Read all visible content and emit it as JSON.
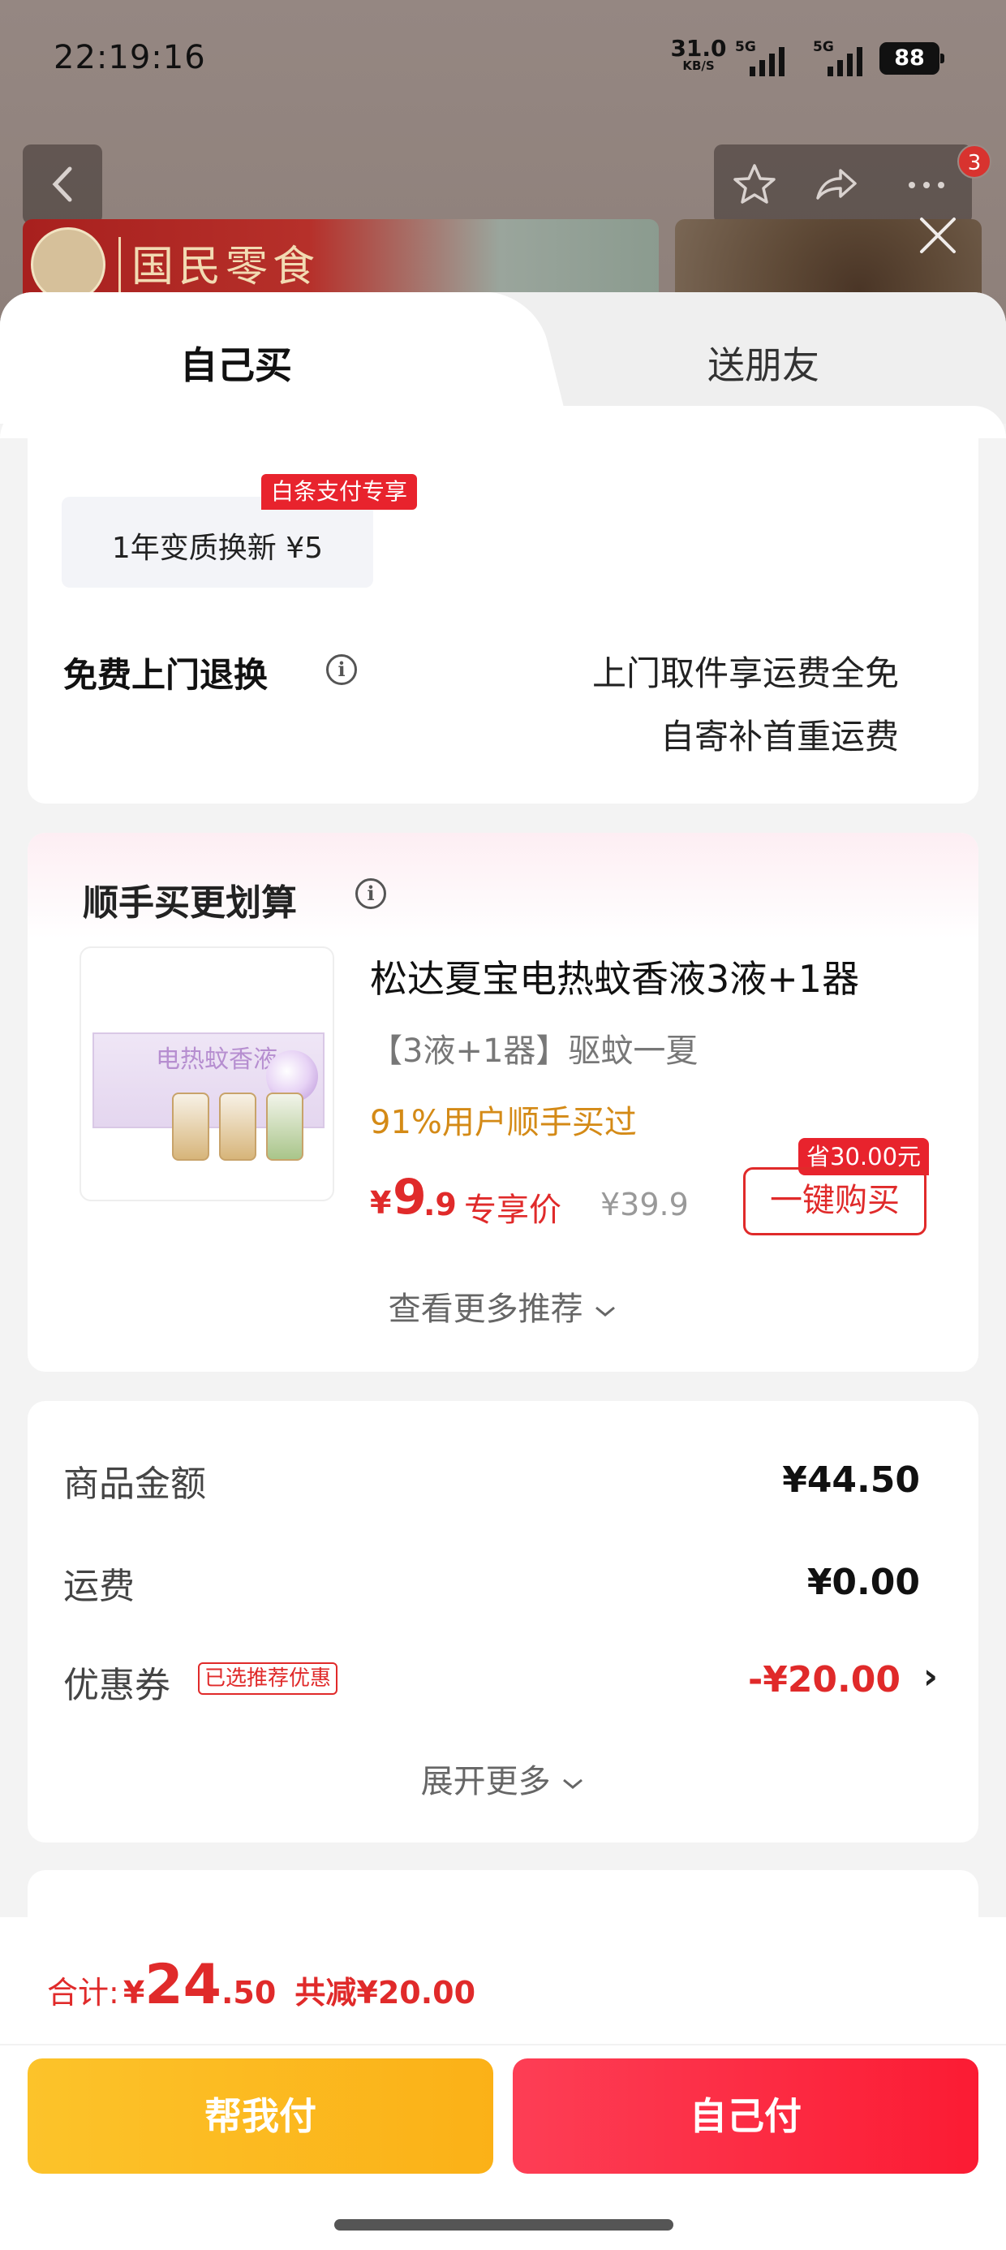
{
  "status_bar": {
    "time": "22:19:16",
    "net_speed": "31.0",
    "net_unit": "KB/S",
    "signal1": "5G",
    "signal2": "5G",
    "battery": "88"
  },
  "header": {
    "cart_count": "3",
    "banner_brand": "国民零食"
  },
  "tabs": [
    {
      "label": "自己买",
      "active": true
    },
    {
      "label": "送朋友",
      "active": false
    }
  ],
  "service": {
    "chip_label": "1年变质换新  ¥5",
    "chip_badge": "白条支付专享",
    "return_title": "免费上门退换",
    "return_line1": "上门取件享运费全免",
    "return_line2": "自寄补首重运费"
  },
  "recommend": {
    "title": "顺手买更划算",
    "product_name": "松达夏宝电热蚊香液3液+1器",
    "product_spec": "【3液+1器】驱蚊一夏",
    "product_box_text": "电热蚊香液",
    "buyers_text": "91%用户顺手买过",
    "price_symbol": "¥",
    "price_int": "9",
    "price_dec": ".9",
    "price_label": "专享价",
    "original_price": "¥39.9",
    "save_badge": "省30.00元",
    "buy_button": "一键购买",
    "more_link": "查看更多推荐"
  },
  "summary": {
    "goods_label": "商品金额",
    "goods_value": "¥44.50",
    "shipping_label": "运费",
    "shipping_value": "¥0.00",
    "coupon_label": "优惠券",
    "coupon_tag": "已选推荐优惠",
    "coupon_value": "-¥20.00",
    "expand_label": "展开更多"
  },
  "footer": {
    "total_label": "合计:",
    "total_symbol": "¥",
    "total_int": "24",
    "total_dec": ".50",
    "reduced": "共减¥20.00",
    "help_pay": "帮我付",
    "self_pay": "自己付"
  },
  "colors": {
    "accent_red": "#e02a2a",
    "help_yellow": "#fbb117",
    "pay_red": "#fb1b33"
  }
}
